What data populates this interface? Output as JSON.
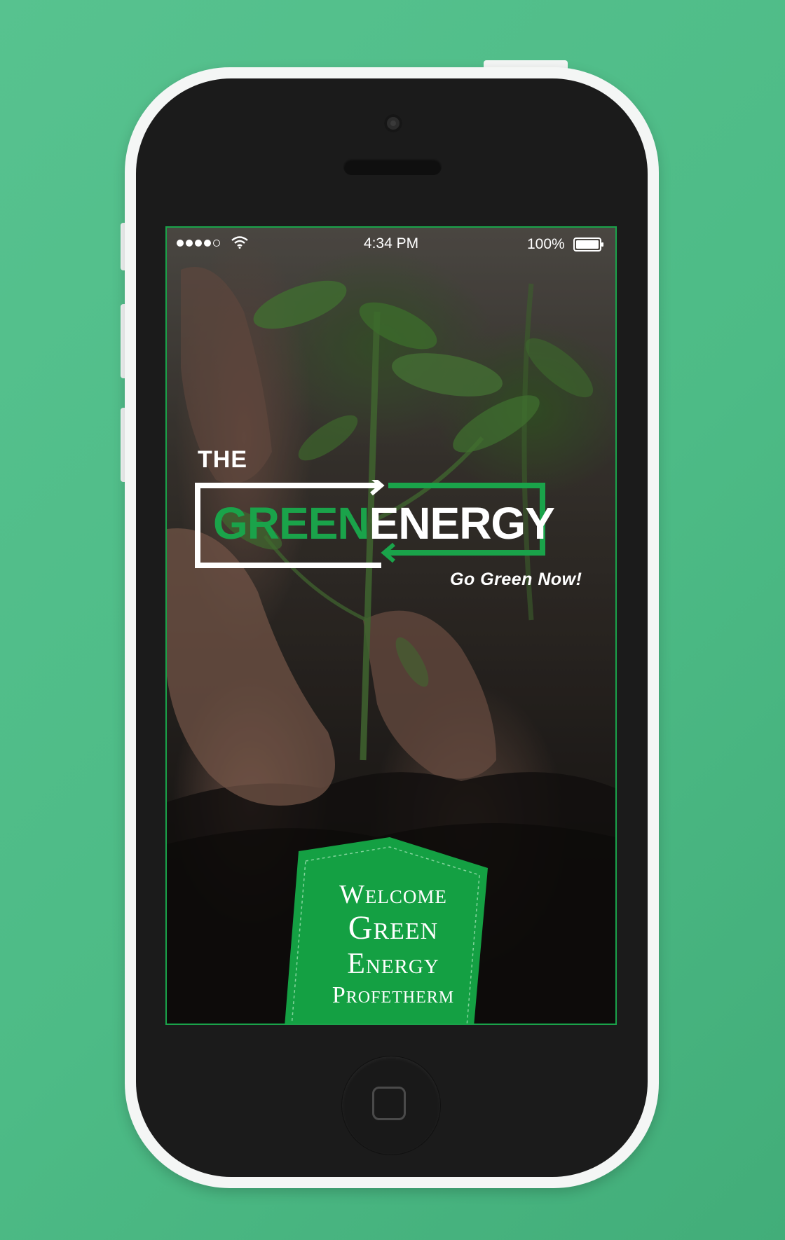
{
  "status_bar": {
    "time": "4:34 PM",
    "battery_percent": "100%",
    "signal_bars": 4,
    "signal_bars_max": 5
  },
  "logo": {
    "prefix": "THE",
    "word_green": "GREEN",
    "word_white": "ENERGY",
    "tagline": "Go Green Now!"
  },
  "welcome": {
    "line1": "Welcome",
    "line2": "Green",
    "line3": "Energy",
    "line4": "Profetherm"
  },
  "colors": {
    "background": "#52bf8a",
    "brand_green": "#1aa34a",
    "phone_frame": "#f4f6f5",
    "phone_face": "#1b1b1b",
    "text_white": "#ffffff"
  },
  "icons": {
    "wifi": "wifi-icon",
    "battery": "battery-icon",
    "camera": "camera-icon",
    "speaker": "speaker-icon",
    "home": "home-button-icon"
  }
}
